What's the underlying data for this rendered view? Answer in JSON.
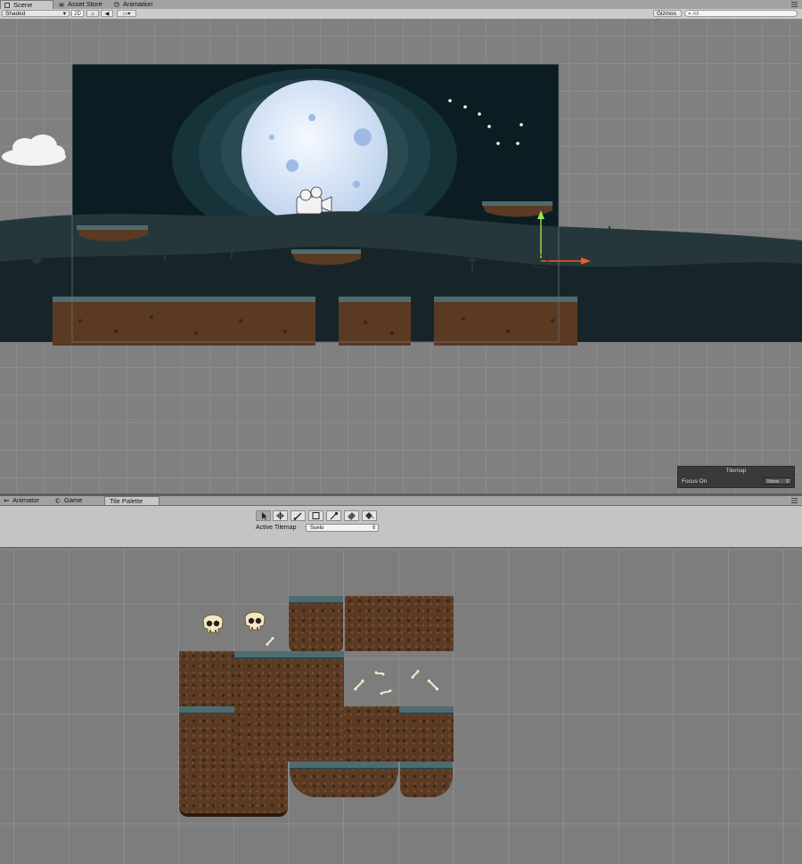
{
  "top_tabs": [
    {
      "label": "Scene",
      "active": true,
      "icon": "scene-icon"
    },
    {
      "label": "Asset Store",
      "active": false,
      "icon": "asset-store-icon"
    },
    {
      "label": "Animation",
      "active": false,
      "icon": "animation-icon"
    }
  ],
  "scene_toolbar": {
    "shading_mode": "Shaded",
    "mode_2d": "2D",
    "gizmos_label": "Gizmos",
    "search_placeholder": "All",
    "icons": [
      "sun-icon",
      "audio-icon",
      "image-effects-icon"
    ]
  },
  "tilemap_overlay": {
    "title": "Tilemap",
    "focus_label": "Focus On",
    "focus_value": "None"
  },
  "bottom_tabs": [
    {
      "label": "Animator",
      "active": false,
      "icon": "animator-icon"
    },
    {
      "label": "Game",
      "active": false,
      "icon": "game-icon"
    },
    {
      "label": "Tile Palette",
      "active": true
    }
  ],
  "palette": {
    "tools": [
      "select-tool-icon",
      "move-tool-icon",
      "paintbrush-tool-icon",
      "box-fill-tool-icon",
      "picker-tool-icon",
      "eraser-tool-icon",
      "flood-fill-tool-icon"
    ],
    "active_tilemap_label": "Active Tilemap",
    "active_tilemap_value": "Suelo"
  },
  "colors": {
    "sky_dark": "#0b1d22",
    "sky_glow": "#2b4b52",
    "moon": "#dfe9f7",
    "hill_far": "#26373b",
    "hill_near": "#17252a",
    "grass": "#4e6c70",
    "dirt": "#5a3a23",
    "gizmo_y": "#9be04a",
    "gizmo_x": "#ef5a25"
  }
}
